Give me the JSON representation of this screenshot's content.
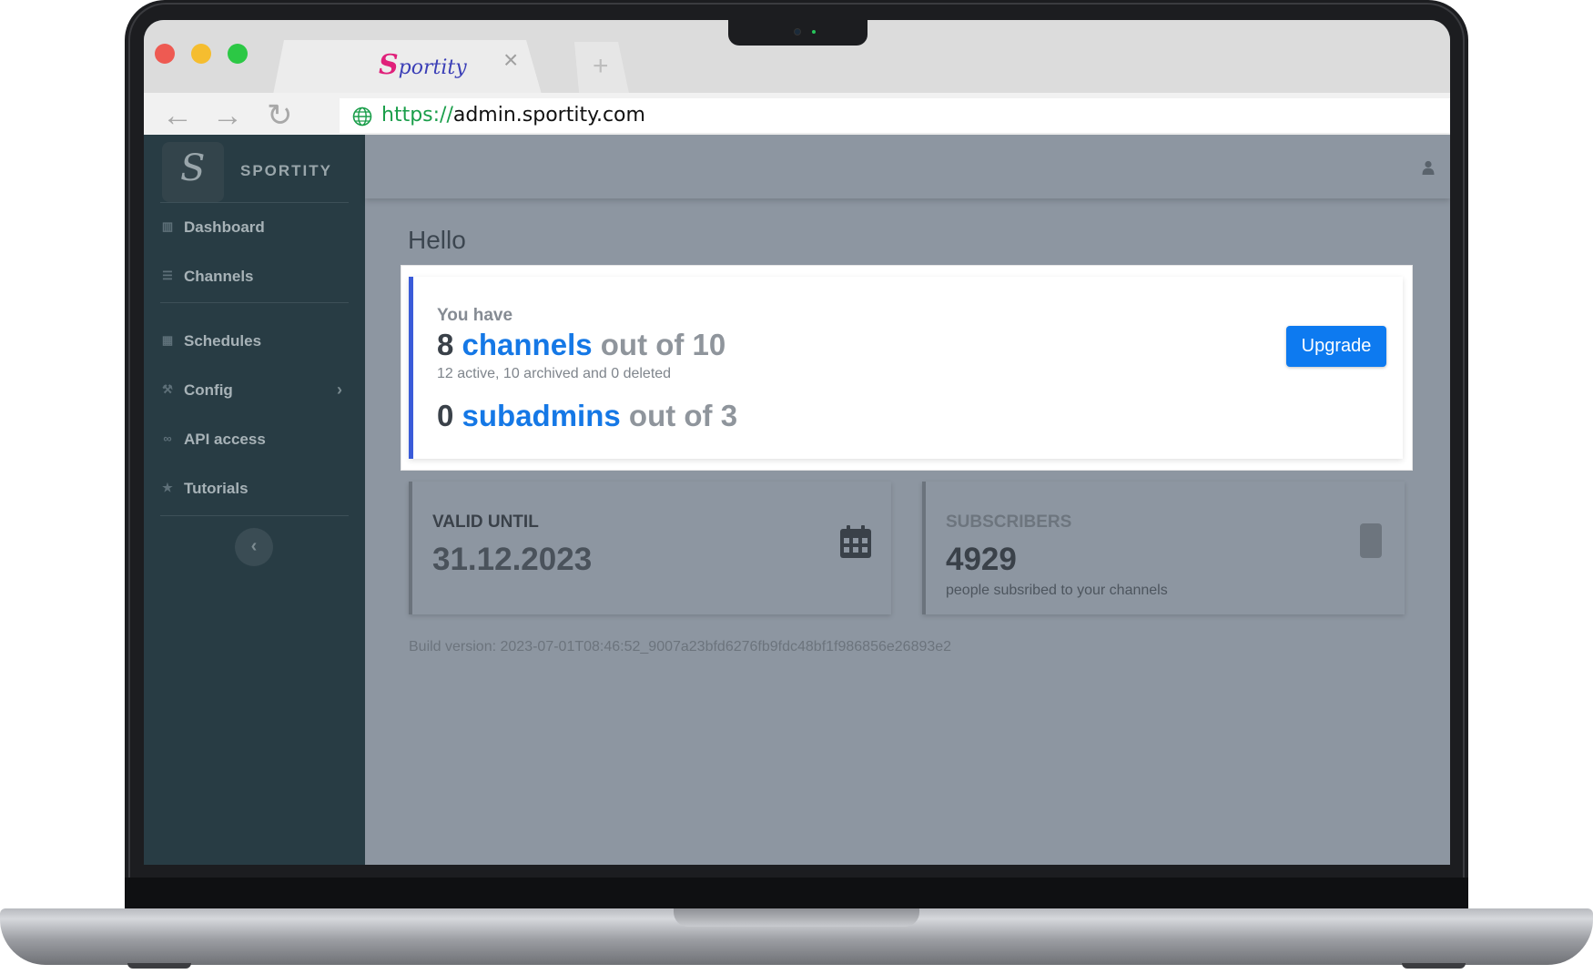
{
  "browser": {
    "tab_title": "portity",
    "tab_logo_letter": "S",
    "tab_close": "×",
    "new_tab": "+",
    "url_protocol": "https://",
    "url_host": "admin.sportity.com",
    "back": "←",
    "forward": "→",
    "reload": "↻"
  },
  "sidebar": {
    "brand_letter": "S",
    "brand_name": "SPORTITY",
    "items": [
      {
        "label": "Dashboard",
        "icon": "chart-icon"
      },
      {
        "label": "Channels",
        "icon": "list-icon"
      },
      {
        "label": "Schedules",
        "icon": "calendar-icon"
      },
      {
        "label": "Config",
        "icon": "wrench-icon",
        "chevron": "›"
      },
      {
        "label": "API access",
        "icon": "link-icon"
      },
      {
        "label": "Tutorials",
        "icon": "star-icon"
      }
    ],
    "collapse": "‹"
  },
  "main": {
    "greeting": "Hello",
    "plan": {
      "intro": "You have",
      "channels_count": "8",
      "channels_link": "channels",
      "channels_limit": "out of 10",
      "channels_note": "12 active, 10 archived and 0 deleted",
      "subadmins_count": "0",
      "subadmins_link": "subadmins",
      "subadmins_limit": "out of 3",
      "upgrade_label": "Upgrade"
    },
    "valid_until": {
      "label": "VALID UNTIL",
      "value": "31.12.2023"
    },
    "subscribers": {
      "label": "SUBSCRIBERS",
      "value": "4929",
      "note": "people subsribed to your channels"
    },
    "build_version": "Build version: 2023-07-01T08:46:52_9007a23bfd6276fb9fdc48bf1f986856e26893e2"
  },
  "colors": {
    "accent": "#0d7af0",
    "sidebar_bg": "#283c44",
    "content_overlay": "#8d96a1",
    "url_protocol": "#1a9e4a",
    "card_border": "#3a5bd9"
  }
}
